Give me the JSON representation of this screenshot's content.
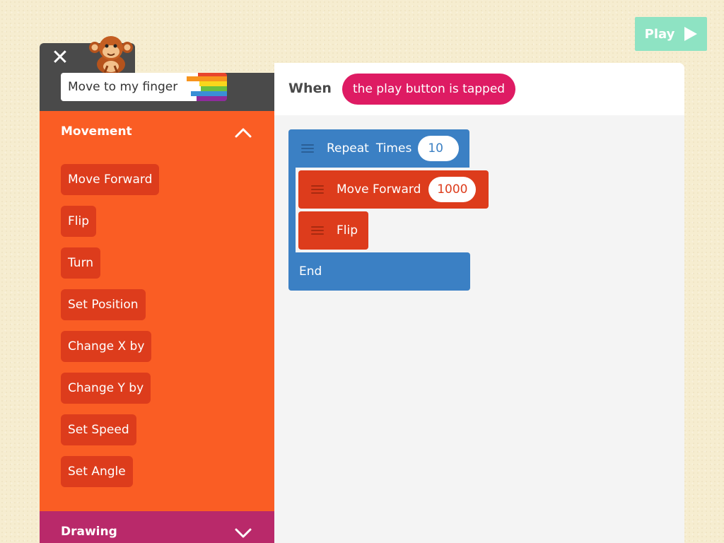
{
  "toolbar": {
    "play_label": "Play"
  },
  "sprite": {
    "name": "Move to my finger"
  },
  "palette": {
    "category": "Movement",
    "blocks": [
      "Move Forward",
      "Flip",
      "Turn",
      "Set Position",
      "Change X by",
      "Change Y by",
      "Set Speed",
      "Set Angle"
    ],
    "next_category": "Drawing"
  },
  "script": {
    "when_label": "When",
    "trigger": "the play button is tapped",
    "repeat": {
      "label": "Repeat",
      "times_label": "Times",
      "times_value": "10",
      "end_label": "End"
    },
    "move_forward": {
      "label": "Move Forward",
      "value": "1000"
    },
    "flip": {
      "label": "Flip"
    }
  },
  "colors": {
    "background": "#f6edd0",
    "play_button": "#8ee3c3",
    "header": "#4a4a4a",
    "movement": "#fa5d24",
    "movement_block": "#dd3c1c",
    "drawing": "#b9296a",
    "trigger": "#de1b63",
    "control_block": "#3b80c4"
  }
}
